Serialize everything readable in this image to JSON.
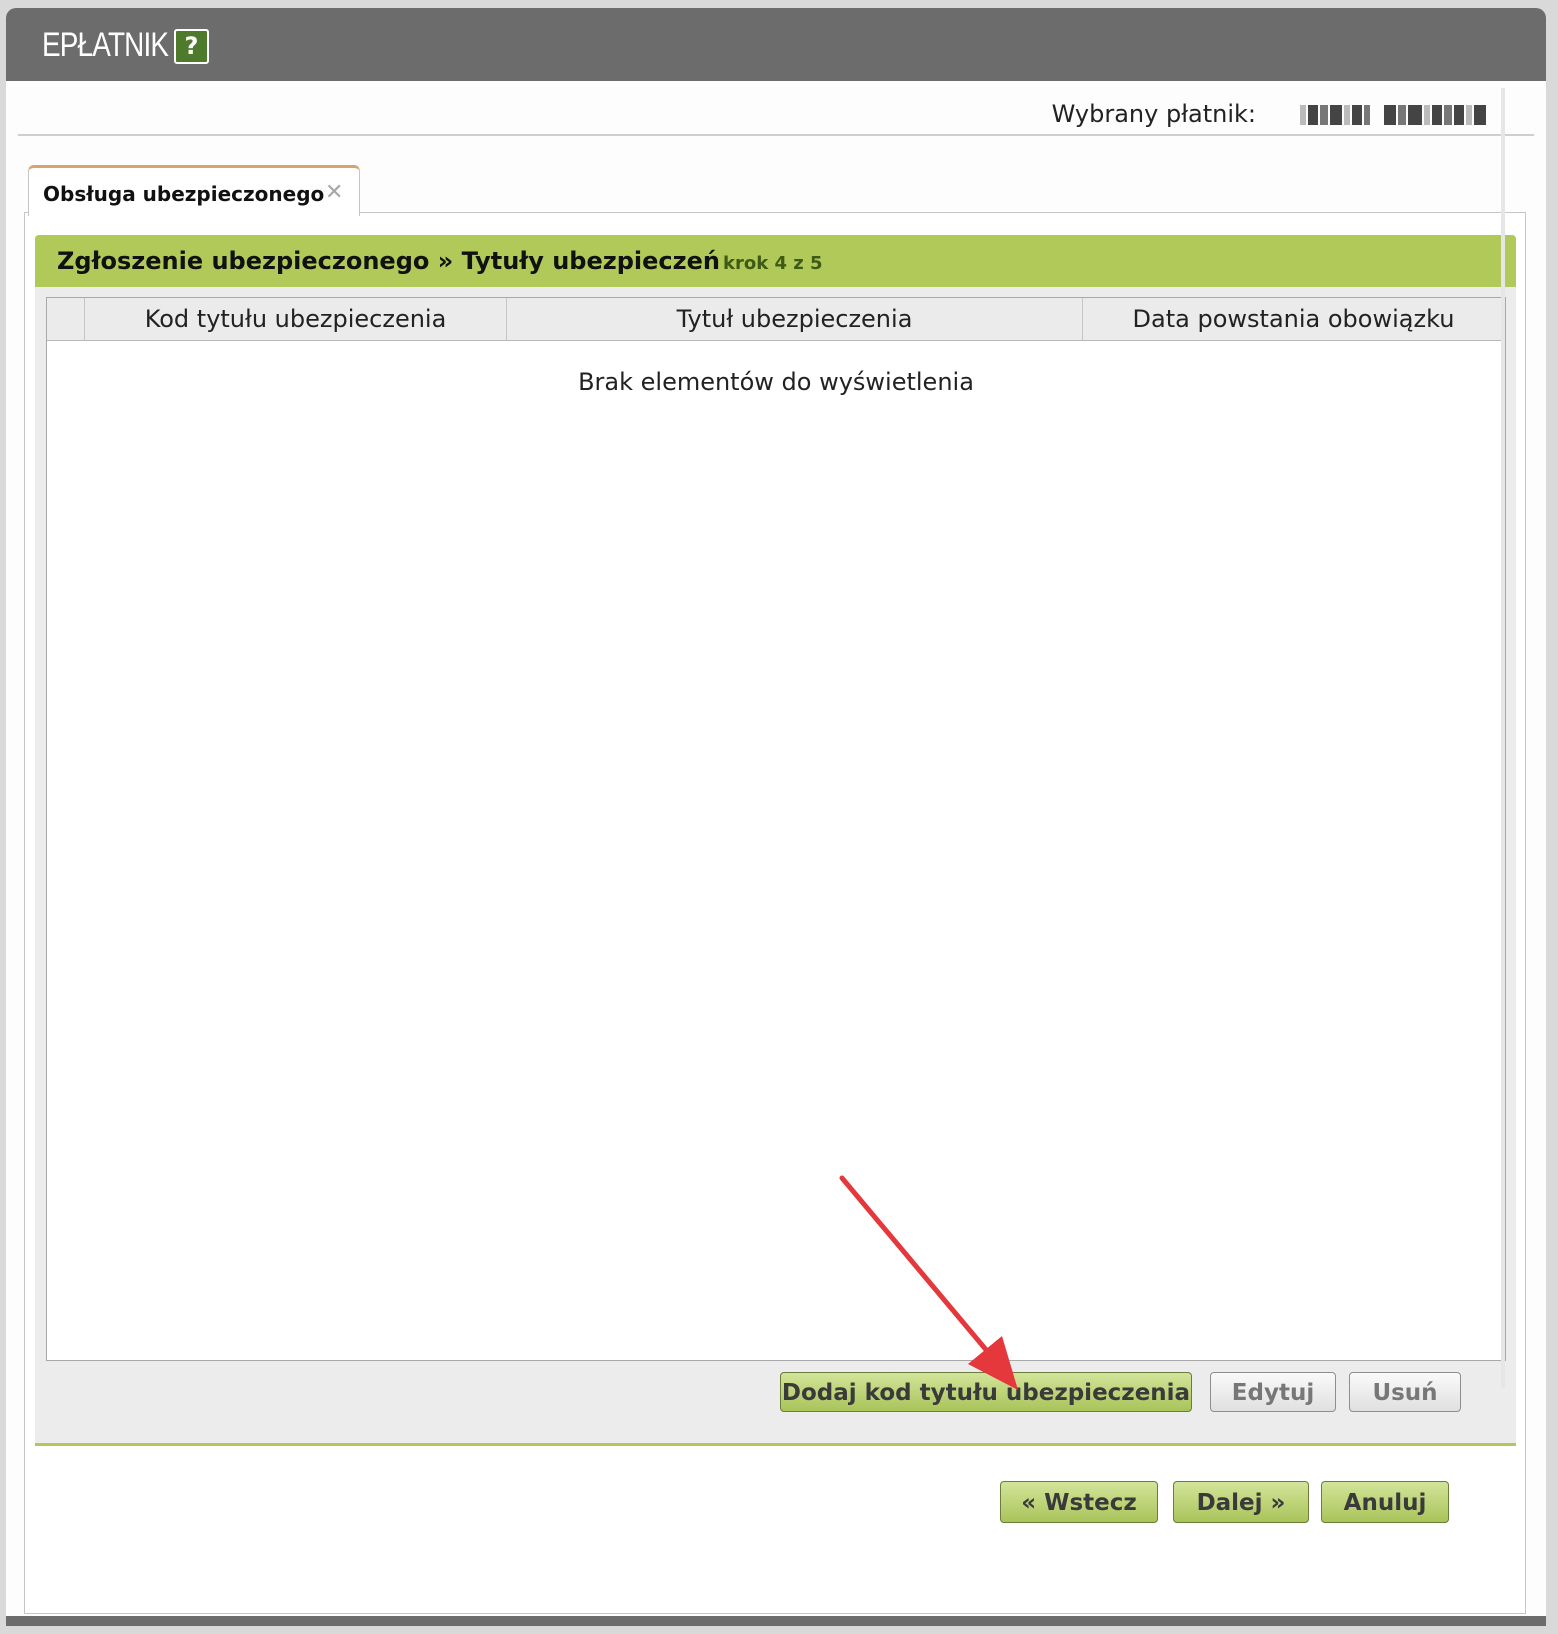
{
  "app": {
    "title": "EPŁATNIK",
    "help_icon": "question-mark-icon",
    "colors": {
      "titlebar": "#6b6c6b",
      "accent_green": "#b0c958",
      "tab_accent": "#d9a36b",
      "annotation_arrow": "#e4383c"
    }
  },
  "payer": {
    "label": "Wybrany płatnik:",
    "value_redacted": true
  },
  "tabs": [
    {
      "label": "Obsługa ubezpieczonego",
      "closable": true,
      "active": true
    }
  ],
  "wizard": {
    "title": "Zgłoszenie ubezpieczonego » Tytuły ubezpieczeń",
    "step": "krok 4 z 5"
  },
  "grid": {
    "columns": [
      "",
      "Kod tytułu ubezpieczenia",
      "Tytuł ubezpieczenia",
      "Data powstania obowiązku"
    ],
    "empty_message": "Brak elementów do wyświetlenia",
    "rows": []
  },
  "grid_actions": {
    "add": "Dodaj kod tytułu ubezpieczenia",
    "edit": "Edytuj",
    "delete": "Usuń"
  },
  "nav": {
    "back": "« Wstecz",
    "next": "Dalej »",
    "cancel": "Anuluj"
  }
}
